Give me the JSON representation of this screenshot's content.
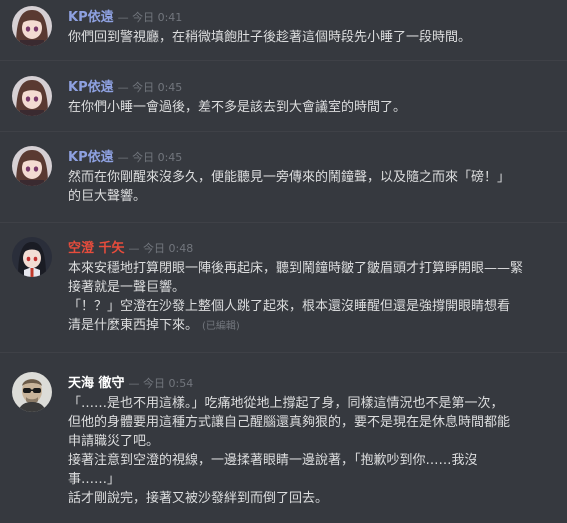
{
  "messages": [
    {
      "author": "KP依遠",
      "author_color": "#8ea1e1",
      "timestamp": "— 今日 0:41",
      "avatar_icon": "anime-girl-brown-hair-avatar-icon",
      "lines": [
        "你們回到警視廳，在稍微填飽肚子後趁著這個時段先小睡了一段時間。"
      ],
      "edited": ""
    },
    {
      "author": "KP依遠",
      "author_color": "#8ea1e1",
      "timestamp": "— 今日 0:45",
      "avatar_icon": "anime-girl-brown-hair-avatar-icon",
      "lines": [
        "在你們小睡一會過後，差不多是該去到大會議室的時間了。"
      ],
      "edited": ""
    },
    {
      "author": "KP依遠",
      "author_color": "#8ea1e1",
      "timestamp": "— 今日 0:45",
      "avatar_icon": "anime-girl-brown-hair-avatar-icon",
      "lines": [
        "然而在你剛醒來沒多久，便能聽見一旁傳來的鬧鐘聲，以及隨之而來「磅！」",
        "的巨大聲響。"
      ],
      "edited": ""
    },
    {
      "author": "空澄 千矢",
      "author_color": "#e74c3c",
      "timestamp": "— 今日 0:48",
      "avatar_icon": "anime-boy-dark-hair-avatar-icon",
      "lines": [
        "本來安穩地打算閉眼一陣後再起床，聽到鬧鐘時皺了皺眉頭才打算睜開眼——緊",
        "接著就是一聲巨響。",
        "「！？」空澄在沙發上整個人跳了起來，根本還沒睡醒但還是強撐開眼睛想看",
        "清是什麼東西掉下來。"
      ],
      "edited": "(已編輯)"
    },
    {
      "author": "天海 徹守",
      "author_color": "#ffffff",
      "timestamp": "— 今日 0:54",
      "avatar_icon": "man-sunglasses-avatar-icon",
      "lines": [
        "「……是也不用這樣。」吃痛地從地上撐起了身，同樣這情況也不是第一次，",
        "但他的身體要用這種方式讓自己醒腦還真夠狠的，要不是現在是休息時間都能",
        "申請職災了吧。",
        "接著注意到空澄的視線，一邊揉著眼睛一邊說著，「抱歉吵到你……我沒",
        "事……」",
        "話才剛說完，接著又被沙發絆到而倒了回去。"
      ],
      "edited": ""
    }
  ]
}
